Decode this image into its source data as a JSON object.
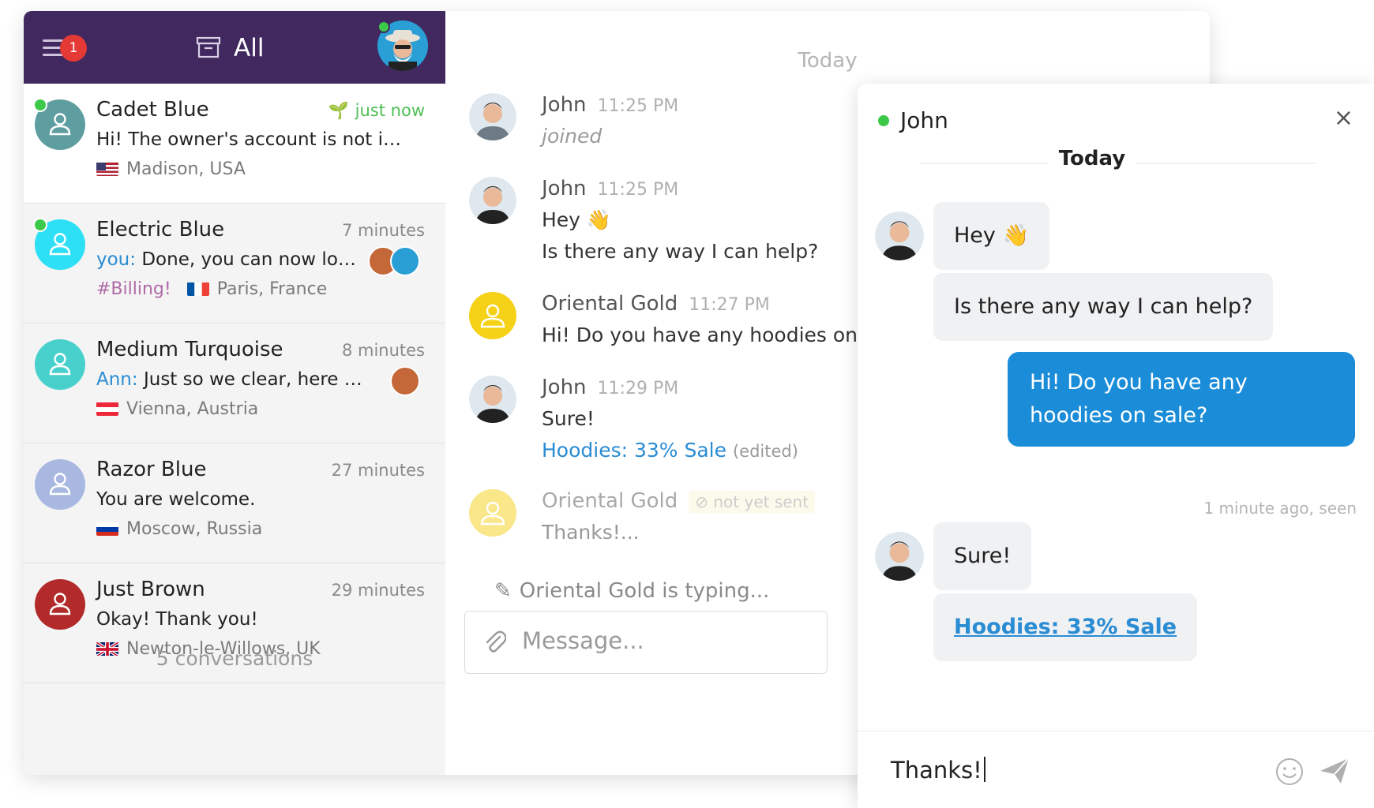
{
  "header": {
    "menu_badge": "1",
    "filter_label": "All"
  },
  "conversations": [
    {
      "name": "Cadet Blue",
      "time": "just now",
      "preview": "Hi! The owner's account is not in…",
      "location": "Madison, USA",
      "flag": "us",
      "avatar_color": "#5f9ea0",
      "online": true
    },
    {
      "name": "Electric Blue",
      "time": "7 minutes",
      "preview_who": "you:",
      "preview": "Done, you can now lo…",
      "tag": "#Billing!",
      "location": "Paris, France",
      "flag": "fr",
      "avatar_color": "#2de0f5",
      "online": true
    },
    {
      "name": "Medium Turquoise",
      "time": "8 minutes",
      "preview_who": "Ann:",
      "preview": "Just so we clear, here is …",
      "location": "Vienna, Austria",
      "flag": "at",
      "avatar_color": "#48d1cc",
      "online": false
    },
    {
      "name": "Razor Blue",
      "time": "27 minutes",
      "preview": "You are welcome.",
      "location": "Moscow, Russia",
      "flag": "ru",
      "avatar_color": "#a8b8e0",
      "online": false
    },
    {
      "name": "Just Brown",
      "time": "29 minutes",
      "preview": "Okay! Thank you!",
      "location": "Newton-le-Willows, UK",
      "flag": "uk",
      "avatar_color": "#b22a2a",
      "online": false
    }
  ],
  "footer": {
    "count": "5 conversations"
  },
  "thread": {
    "day": "Today",
    "messages": [
      {
        "author": "John",
        "time": "11:25 PM",
        "lines": [
          "joined"
        ]
      },
      {
        "author": "John",
        "time": "11:25 PM",
        "lines": [
          "Hey 👋",
          "Is there any way I can help?"
        ]
      },
      {
        "author": "Oriental Gold",
        "time": "11:27 PM",
        "lines": [
          "Hi! Do you have any hoodies on"
        ]
      },
      {
        "author": "John",
        "time": "11:29 PM",
        "lines": [
          "Sure!",
          "Hoodies: 33% Sale"
        ],
        "edited": "(edited)"
      },
      {
        "author": "Oriental Gold",
        "status": "not yet sent",
        "lines": [
          "Thanks!..."
        ]
      }
    ],
    "typing": "Oriental Gold is typing...",
    "composer_placeholder": "Message..."
  },
  "widget": {
    "name": "John",
    "close": "×",
    "day": "Today",
    "bubbles_in_1": [
      "Hey 👋",
      "Is there any way I can help?"
    ],
    "bubble_out": "Hi! Do you have any hoodies on sale?",
    "seen": "1 minute ago, seen",
    "bubbles_in_2": [
      "Sure!",
      "Hoodies: 33% Sale"
    ],
    "input_value": "Thanks!"
  },
  "colors": {
    "topbar": "#41295f",
    "accent": "#1a8cd8",
    "online": "#3cc94a",
    "badge": "#e53935"
  }
}
